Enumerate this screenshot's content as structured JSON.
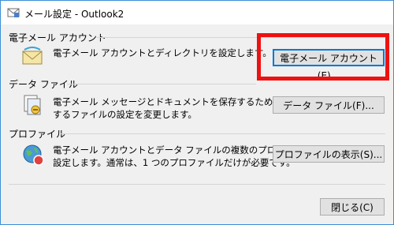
{
  "window": {
    "title": "メール設定 - Outlook2"
  },
  "groups": {
    "email": {
      "label": "電子メール アカウント",
      "desc": "電子メール アカウントとディレクトリを設定します。",
      "button": "電子メール アカウント(E)..."
    },
    "datafile": {
      "label": "データ ファイル",
      "desc_line1": "電子メール メッセージとドキュメントを保存するために使用",
      "desc_line2": "するファイルの設定を変更します。",
      "button": "データ ファイル(F)..."
    },
    "profile": {
      "label": "プロファイル",
      "desc_line1": "電子メール アカウントとデータ ファイルの複数のプロファイルを",
      "desc_line2": "設定します。通常は、1 つのプロファイルだけが必要です。",
      "button": "プロファイルの表示(S)..."
    }
  },
  "footer": {
    "close": "閉じる(C)"
  },
  "colors": {
    "highlight": "#ee1111",
    "accent": "#0078d7"
  },
  "icons": [
    "mail-settings-icon",
    "envelope-icon",
    "data-file-icon",
    "profile-globe-icon"
  ]
}
